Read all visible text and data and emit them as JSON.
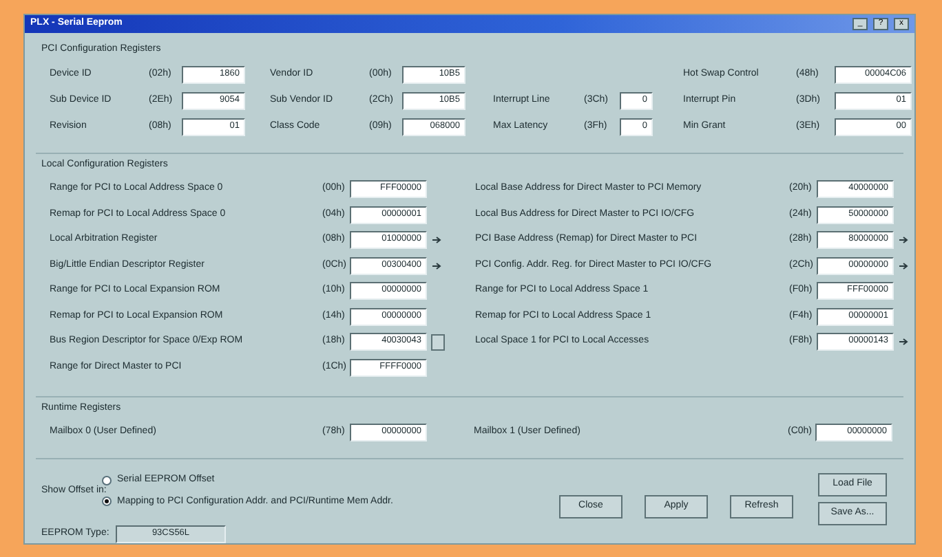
{
  "window": {
    "title": "PLX - Serial Eeprom",
    "controls": [
      "_",
      "?",
      "x"
    ]
  },
  "pci_configuration": {
    "title": "PCI Configuration Registers",
    "columns": [
      [
        {
          "label": "Device ID",
          "offset": "(02h)",
          "value": "1860"
        },
        {
          "label": "Sub Device ID",
          "offset": "(2Eh)",
          "value": "9054"
        },
        {
          "label": "Revision",
          "offset": "(08h)",
          "value": "01"
        }
      ],
      [
        {
          "label": "Vendor ID",
          "offset": "(00h)",
          "value": "10B5"
        },
        {
          "label": "Sub Vendor ID",
          "offset": "(2Ch)",
          "value": "10B5"
        },
        {
          "label": "Class Code",
          "offset": "(09h)",
          "value": "068000"
        }
      ],
      [
        {
          "label": "Interrupt Line",
          "offset": "(3Ch)",
          "value": "0"
        },
        {
          "label": "Max Latency",
          "offset": "(3Fh)",
          "value": "0"
        }
      ],
      [
        {
          "label": "Hot Swap Control",
          "offset": "(48h)",
          "value": "00004C06"
        },
        {
          "label": "Interrupt Pin",
          "offset": "(3Dh)",
          "value": "01"
        },
        {
          "label": "Min Grant",
          "offset": "(3Eh)",
          "value": "00"
        }
      ]
    ]
  },
  "local_configuration": {
    "title": "Local Configuration Registers",
    "columns": [
      [
        {
          "label": "Range for PCI to Local Address Space 0",
          "offset": "(00h)",
          "value": "FFF00000",
          "kind": "plain"
        },
        {
          "label": "Remap for PCI to Local Address Space 0",
          "offset": "(04h)",
          "value": "00000001",
          "kind": "plain"
        },
        {
          "label": "Local Arbitration Register",
          "offset": "(08h)",
          "value": "01000000",
          "kind": "arrow"
        },
        {
          "label": "Big/Little Endian Descriptor Register",
          "offset": "(0Ch)",
          "value": "00300400",
          "kind": "arrow"
        },
        {
          "label": "Range for PCI to Local Expansion ROM",
          "offset": "(10h)",
          "value": "00000000",
          "kind": "plain"
        },
        {
          "label": "Remap for PCI to Local Expansion ROM",
          "offset": "(14h)",
          "value": "00000000",
          "kind": "plain"
        },
        {
          "label": "Bus Region Descriptor for Space 0/Exp ROM",
          "offset": "(18h)",
          "value": "40030043",
          "kind": "button"
        },
        {
          "label": "Range for Direct Master to PCI",
          "offset": "(1Ch)",
          "value": "FFFF0000",
          "kind": "plain"
        }
      ],
      [
        {
          "label": "Local Base Address for Direct Master to PCI Memory",
          "offset": "(20h)",
          "value": "40000000",
          "kind": "plain"
        },
        {
          "label": "Local Bus Address for Direct Master to PCI IO/CFG",
          "offset": "(24h)",
          "value": "50000000",
          "kind": "plain"
        },
        {
          "label": "PCI Base Address (Remap) for Direct Master to PCI",
          "offset": "(28h)",
          "value": "80000000",
          "kind": "arrow"
        },
        {
          "label": "PCI Config. Addr. Reg. for Direct Master to PCI IO/CFG",
          "offset": "(2Ch)",
          "value": "00000000",
          "kind": "arrow"
        },
        {
          "label": "Range for PCI to Local Address Space 1",
          "offset": "(F0h)",
          "value": "FFF00000",
          "kind": "plain"
        },
        {
          "label": "Remap for PCI to Local Address Space 1",
          "offset": "(F4h)",
          "value": "00000001",
          "kind": "plain"
        },
        {
          "label": "Local Space 1 for PCI to Local Accesses",
          "offset": "(F8h)",
          "value": "00000143",
          "kind": "arrow"
        }
      ]
    ]
  },
  "runtime": {
    "title": "Runtime Registers",
    "items": [
      {
        "label": "Mailbox 0 (User Defined)",
        "offset": "(78h)",
        "value": "00000000"
      },
      {
        "label": "Mailbox 1 (User Defined)",
        "offset": "(C0h)",
        "value": "00000000"
      }
    ]
  },
  "show_offset": {
    "label": "Show Offset in:",
    "options": [
      {
        "label": "Serial EEPROM Offset",
        "selected": false
      },
      {
        "label": "Mapping to PCI Configuration Addr. and PCI/Runtime Mem Addr.",
        "selected": true
      }
    ]
  },
  "eeprom_type": {
    "label": "EEPROM Type:",
    "value": "93CS56L"
  },
  "buttons": [
    "Close",
    "Apply",
    "Refresh"
  ],
  "file_buttons": [
    "Load File",
    "Save As..."
  ]
}
